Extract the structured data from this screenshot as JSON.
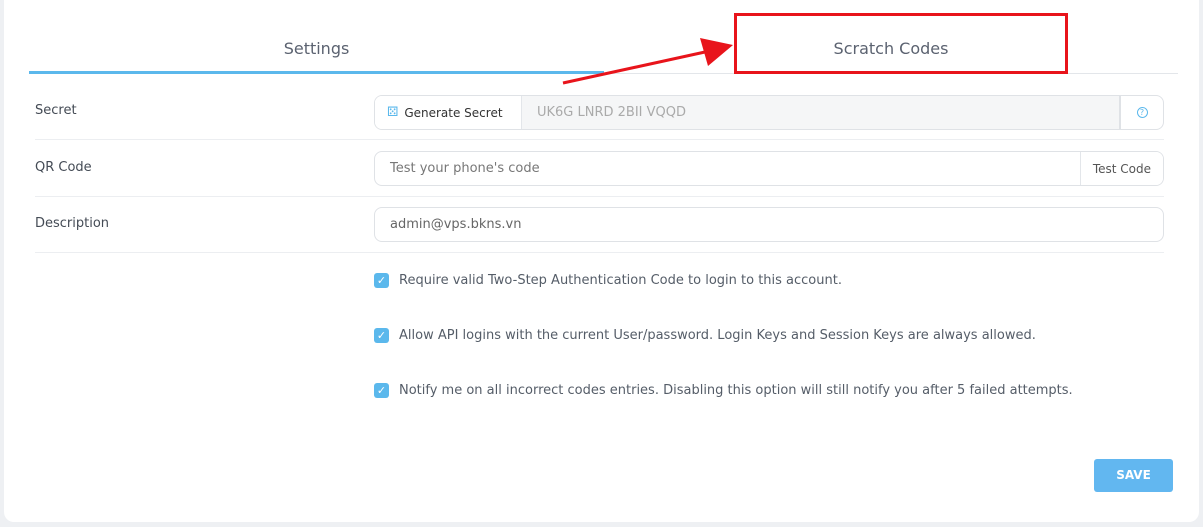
{
  "tabs": [
    {
      "label": "Settings",
      "active": true
    },
    {
      "label": "Scratch Codes",
      "active": false
    }
  ],
  "form": {
    "secret": {
      "label": "Secret",
      "button": "Generate Secret",
      "value": "UK6G LNRD 2BII VQQD",
      "help_icon": "question-circle-icon"
    },
    "qr": {
      "label": "QR Code",
      "placeholder": "Test your phone's code",
      "button": "Test Code"
    },
    "description": {
      "label": "Description",
      "value": "admin@vps.bkns.vn"
    }
  },
  "options": [
    {
      "label": "Require valid Two-Step Authentication Code to login to this account.",
      "checked": true
    },
    {
      "label": "Allow API logins with the current User/password. Login Keys and Session Keys are always allowed.",
      "checked": true
    },
    {
      "label": "Notify me on all incorrect codes entries. Disabling this option will still notify you after 5 failed attempts.",
      "checked": true
    }
  ],
  "save_label": "SAVE",
  "colors": {
    "accent": "#5bb8ec",
    "annotation": "#e8141b"
  }
}
